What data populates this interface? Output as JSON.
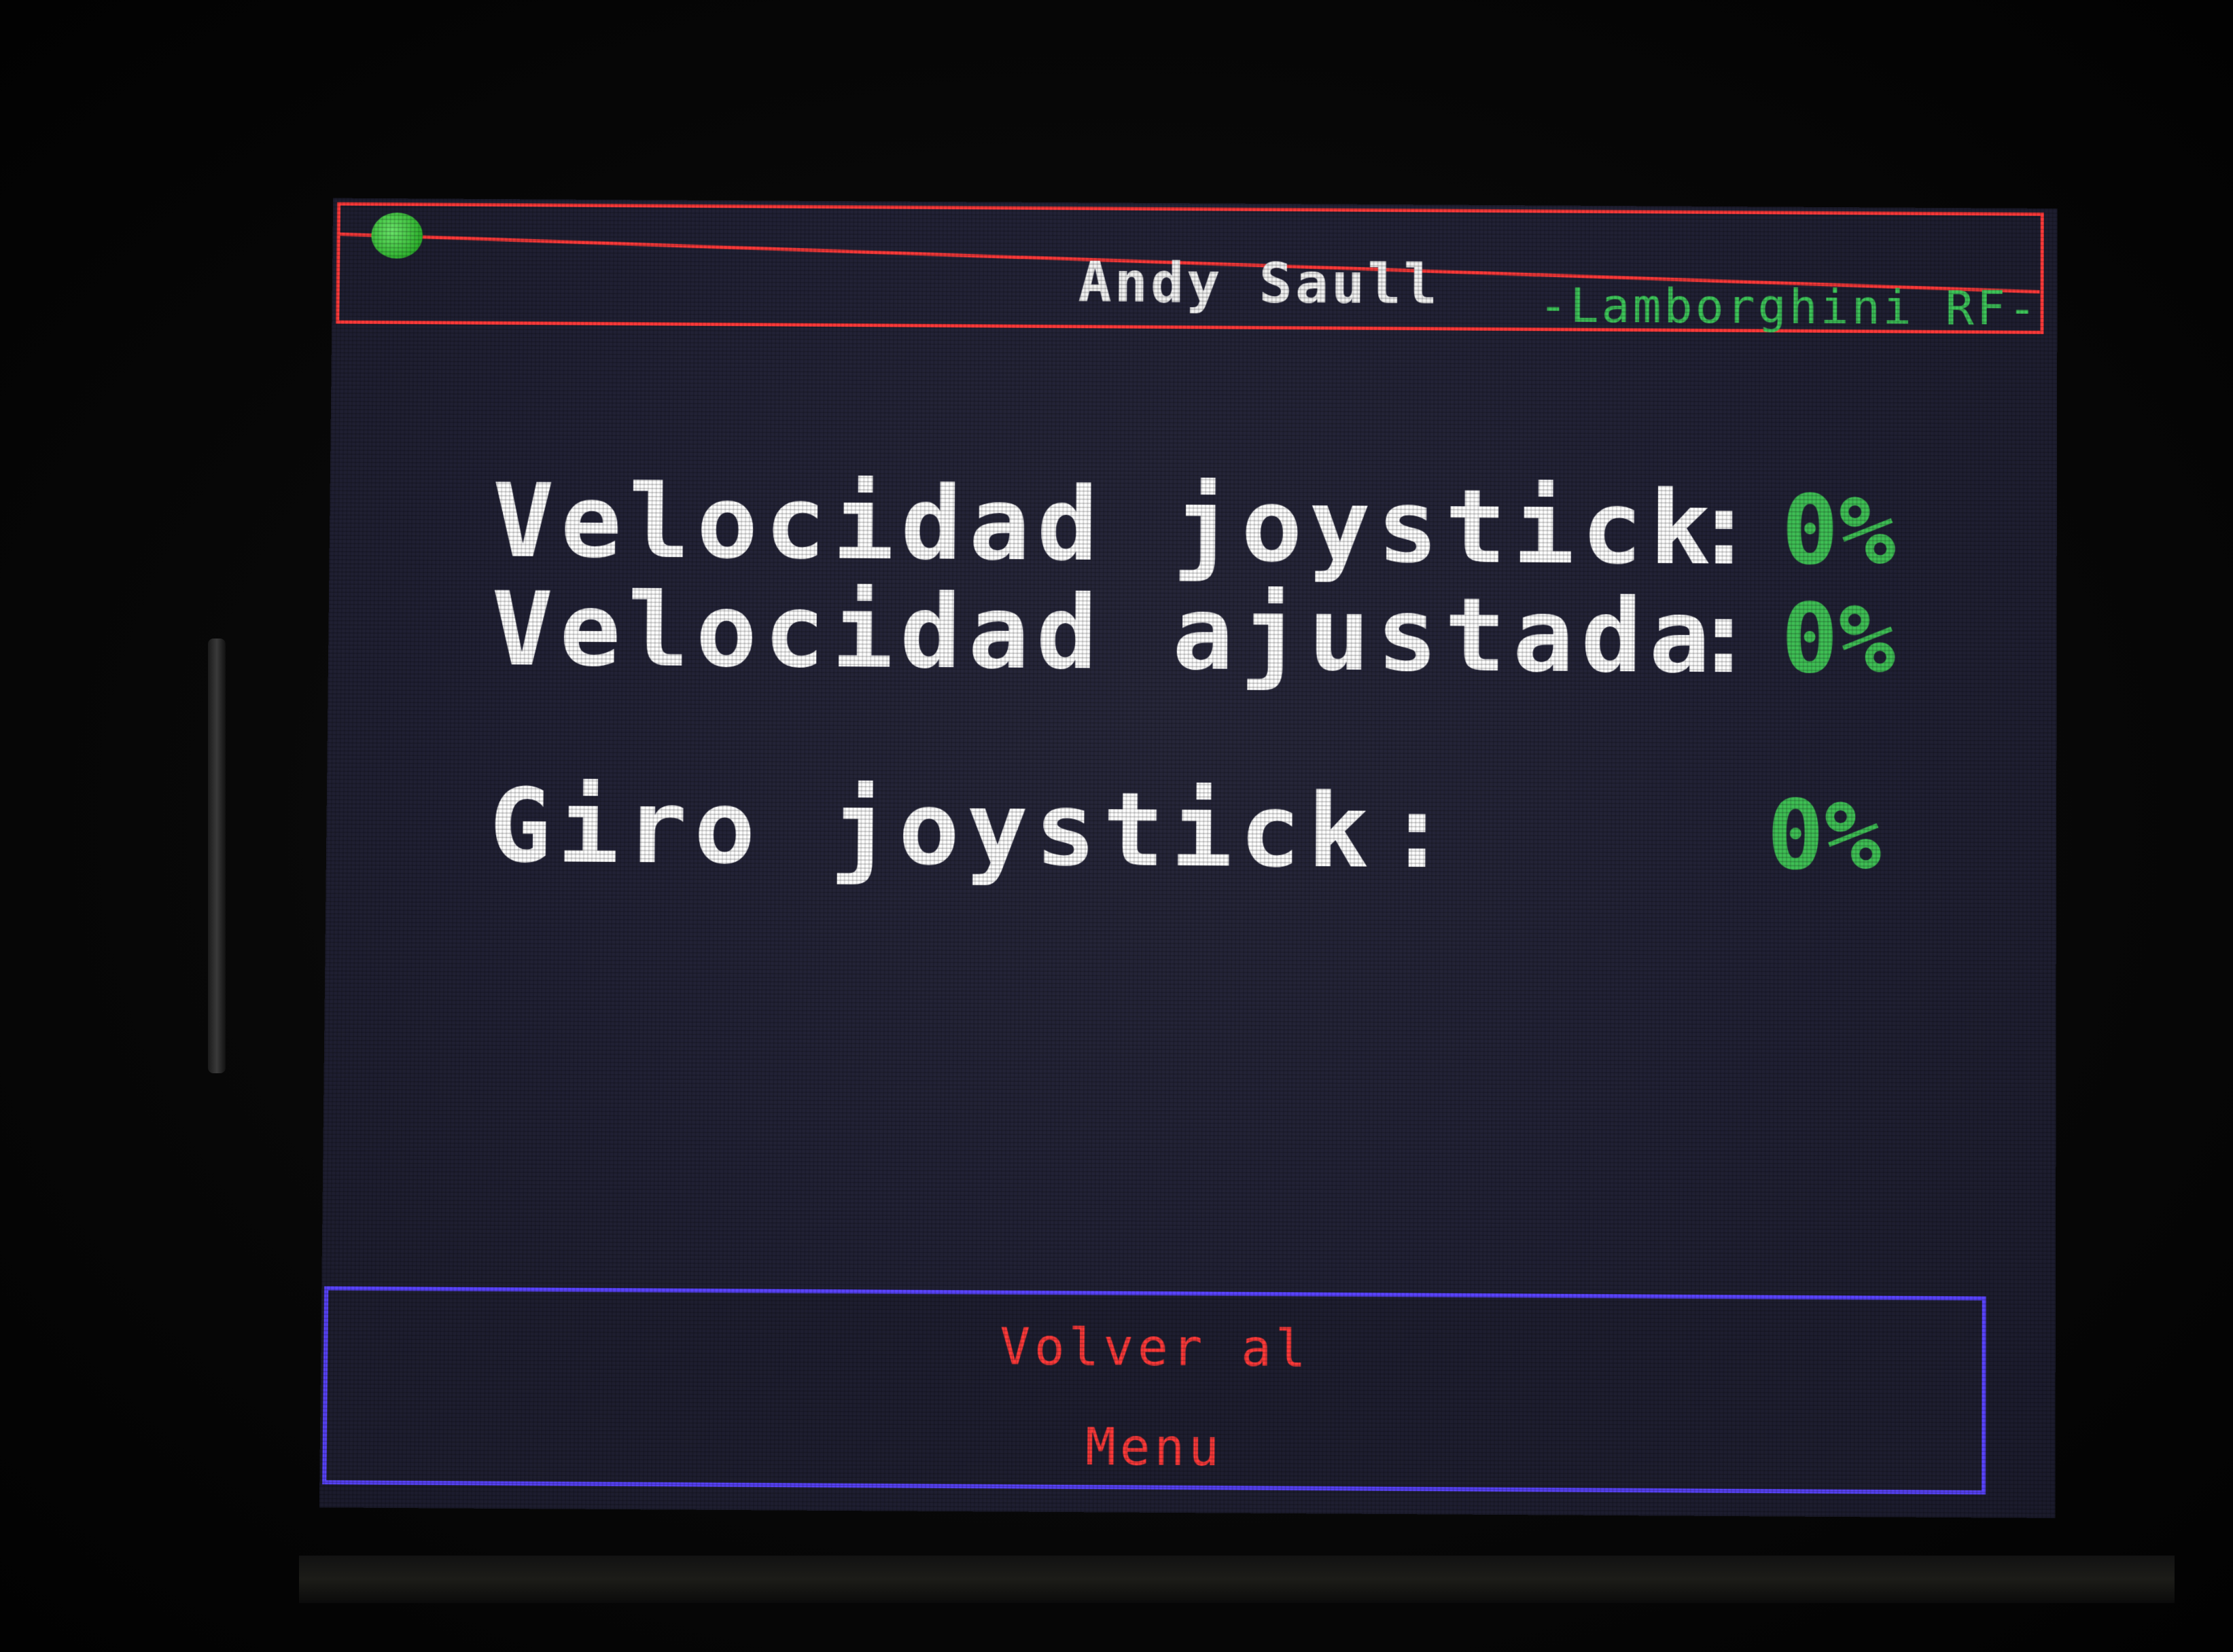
{
  "header": {
    "user_name": "Andy Saull",
    "model_name": "-Lamborghini RF-",
    "status_icon": "green-status-dot",
    "border_color": "#ff3a3a"
  },
  "readings": [
    {
      "label": "Velocidad joystick",
      "colon": ":",
      "value": "0%"
    },
    {
      "label": "Velocidad ajustada",
      "colon": ":",
      "value": "0%"
    },
    {
      "label": "Giro joystick",
      "colon": ":",
      "value": "0%"
    }
  ],
  "footer": {
    "button_line1": "Volver al",
    "button_line2": "Menu",
    "border_color": "#5a44ff",
    "text_color": "#ff3a3a"
  },
  "colors": {
    "screen_background": "#222236",
    "value_green": "#3fbf55",
    "label_white": "#ffffff"
  }
}
